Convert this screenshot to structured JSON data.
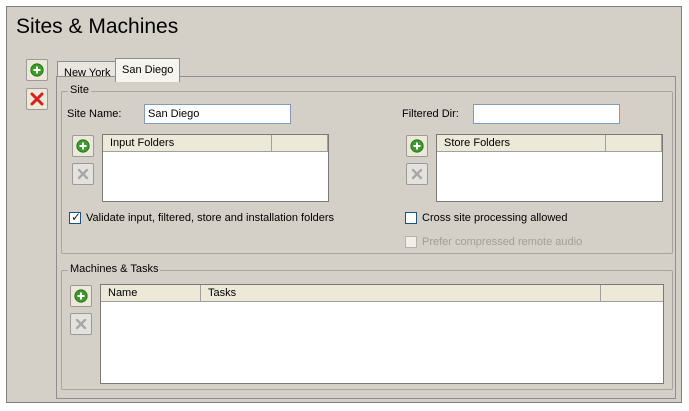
{
  "page": {
    "title": "Sites & Machines"
  },
  "tabs": [
    {
      "label": "New York",
      "active": false
    },
    {
      "label": "San Diego",
      "active": true
    }
  ],
  "site_group": {
    "legend": "Site",
    "site_name_label": "Site Name:",
    "site_name_value": "San Diego",
    "filtered_dir_label": "Filtered Dir:",
    "filtered_dir_value": "",
    "input_folders": {
      "columns": [
        "Input Folders",
        ""
      ]
    },
    "store_folders": {
      "columns": [
        "Store Folders",
        ""
      ]
    },
    "validate_checkbox": {
      "label": "Validate input, filtered, store and installation folders",
      "checked": true
    },
    "cross_site_checkbox": {
      "label": "Cross site processing allowed",
      "checked": false
    },
    "prefer_compressed_checkbox": {
      "label": "Prefer compressed remote audio",
      "checked": false,
      "disabled": true
    }
  },
  "machines_group": {
    "legend": "Machines & Tasks",
    "columns": [
      "Name",
      "Tasks",
      ""
    ]
  },
  "colors": {
    "add_green": "#3d9a2c",
    "delete_red": "#d62020",
    "window_bg": "#d4d0c8"
  }
}
